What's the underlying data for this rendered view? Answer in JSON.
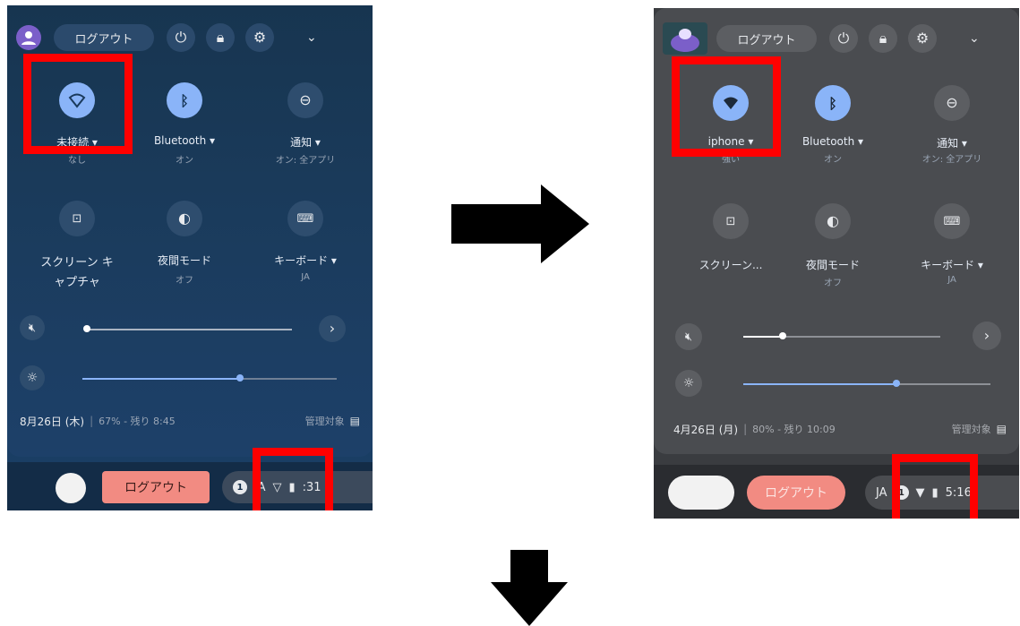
{
  "left_panel": {
    "logout_pill": "ログアウト",
    "tiles_row1": [
      {
        "label": "未接続 ▾",
        "sub": "なし",
        "icon": "wifi-icon"
      },
      {
        "label": "Bluetooth ▾",
        "sub": "オン",
        "icon": "bluetooth-icon"
      },
      {
        "label": "通知 ▾",
        "sub": "オン: 全アプリ",
        "icon": "notification-icon"
      }
    ],
    "tiles_row2": [
      {
        "label": "スクリーン キ",
        "label2": "ャプチャ",
        "icon": "screen-capture-icon"
      },
      {
        "label": "夜間モード",
        "sub": "オフ",
        "icon": "night-mode-icon"
      },
      {
        "label": "キーボード ▾",
        "sub": "JA",
        "icon": "keyboard-icon"
      }
    ],
    "volume_level": 0.02,
    "brightness_level": 0.62,
    "date": "8月26日 (木)",
    "battery": "67% - 残り 8:45",
    "managed": "管理対象",
    "shelf_logout": "ログアウト",
    "shelf_badge": "1",
    "shelf_ime": "JA",
    "shelf_time": ":31"
  },
  "right_panel": {
    "logout_pill": "ログアウト",
    "tiles_row1": [
      {
        "label": "iphone ▾",
        "sub": "強い",
        "icon": "wifi-connected-icon"
      },
      {
        "label": "Bluetooth ▾",
        "sub": "オン",
        "icon": "bluetooth-icon"
      },
      {
        "label": "通知 ▾",
        "sub": "オン: 全アプリ",
        "icon": "notification-icon"
      }
    ],
    "tiles_row2": [
      {
        "label": "スクリーン...",
        "icon": "screen-capture-icon"
      },
      {
        "label": "夜間モード",
        "sub": "オフ",
        "icon": "night-mode-icon"
      },
      {
        "label": "キーボード ▾",
        "sub": "JA",
        "icon": "keyboard-icon"
      }
    ],
    "volume_level": 0.2,
    "brightness_level": 0.62,
    "date": "4月26日 (月)",
    "battery": "80% - 残り 10:09",
    "managed": "管理対象",
    "shelf_logout": "ログアウト",
    "shelf_ime": "JA",
    "shelf_badge": "1",
    "shelf_time": "5:16"
  },
  "colors": {
    "highlight": "#ff0000",
    "tile_active": "#8ab4f8",
    "logout_button": "#f28b82"
  }
}
